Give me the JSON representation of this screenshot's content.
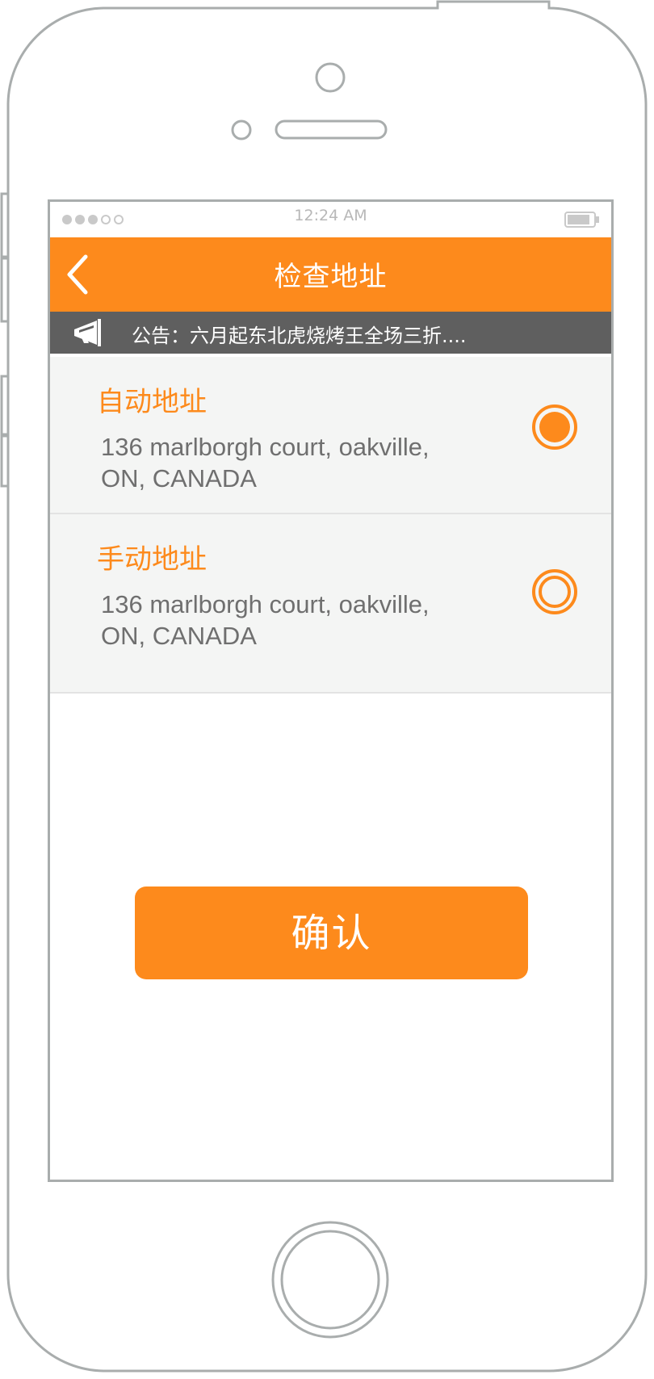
{
  "status_bar": {
    "time": "12:24 AM",
    "signal_icon": "signal-dots-icon",
    "battery_icon": "battery-icon"
  },
  "nav": {
    "title": "检查地址",
    "back_icon": "chevron-left-icon"
  },
  "notice": {
    "icon": "megaphone-icon",
    "text": "公告：六月起东北虎烧烤王全场三折...."
  },
  "addresses": [
    {
      "title": "自动地址",
      "line1": "136 marlborgh court, oakville,",
      "line2": "ON, CANADA",
      "selected": true
    },
    {
      "title": "手动地址",
      "line1": "136 marlborgh court, oakville,",
      "line2": "ON, CANADA",
      "selected": false
    }
  ],
  "confirm_label": "确认",
  "colors": {
    "accent": "#fd8a1c",
    "notice_bg": "#5f5f5f",
    "list_bg": "#f4f5f4",
    "frame": "#a9adad"
  }
}
